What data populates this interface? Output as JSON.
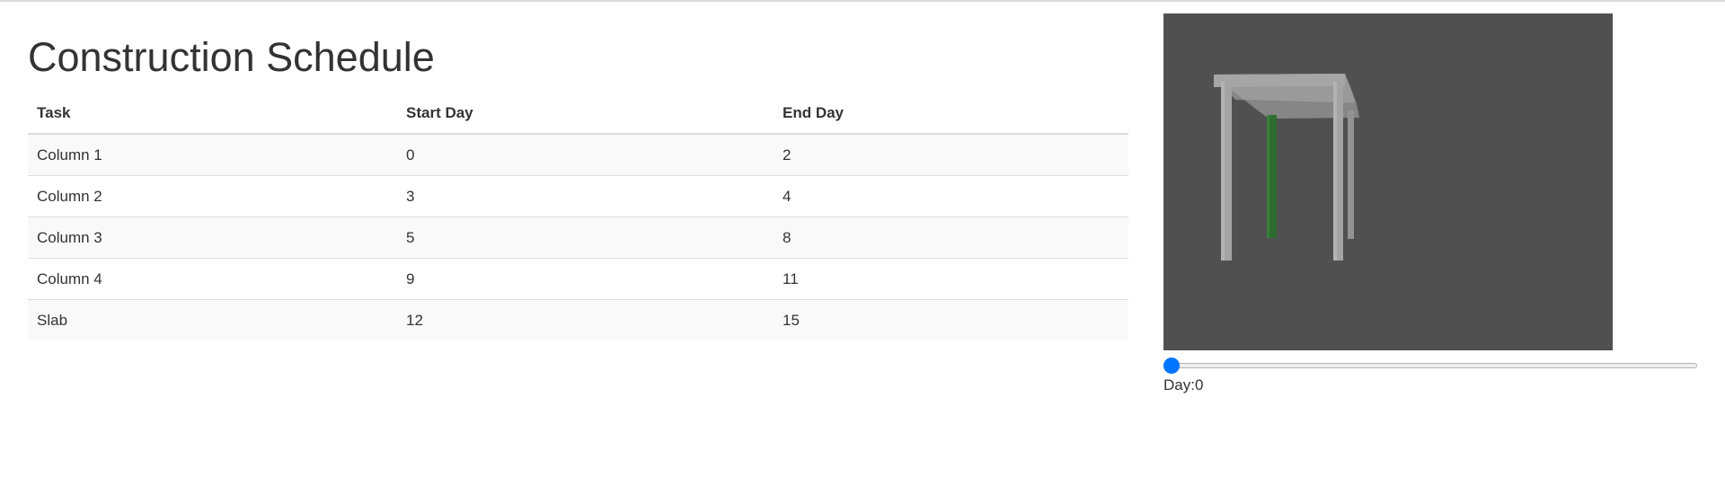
{
  "page": {
    "title": "Construction Schedule"
  },
  "schedule": {
    "headers": {
      "task": "Task",
      "start": "Start Day",
      "end": "End Day"
    },
    "rows": [
      {
        "task": "Column 1",
        "start": "0",
        "end": "2"
      },
      {
        "task": "Column 2",
        "start": "3",
        "end": "4"
      },
      {
        "task": "Column 3",
        "start": "5",
        "end": "8"
      },
      {
        "task": "Column 4",
        "start": "9",
        "end": "11"
      },
      {
        "task": "Slab",
        "start": "12",
        "end": "15"
      }
    ]
  },
  "viewer": {
    "background_color": "#505050",
    "element_color": "#8c8c8c",
    "active_element_color": "#2e6b2e"
  },
  "timeline": {
    "value": 0,
    "label_prefix": "Day:",
    "value_text": "0"
  },
  "colors": {
    "slider_accent": "#0075ff"
  }
}
